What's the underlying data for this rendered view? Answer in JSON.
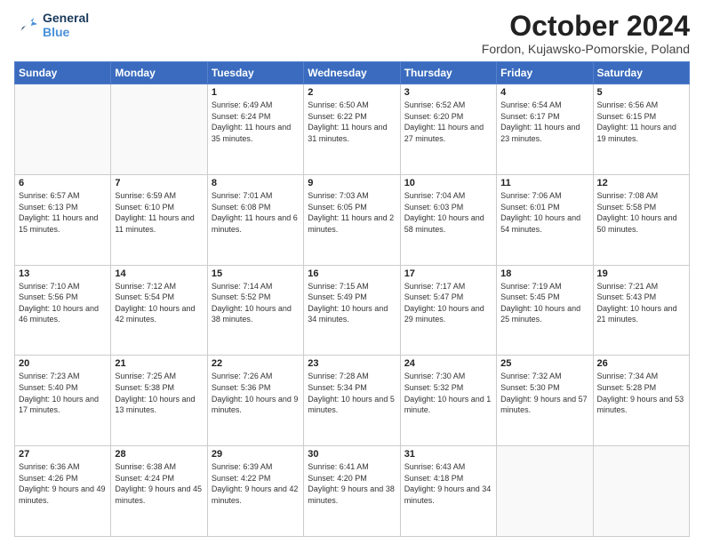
{
  "header": {
    "logo_line1": "General",
    "logo_line2": "Blue",
    "month": "October 2024",
    "location": "Fordon, Kujawsko-Pomorskie, Poland"
  },
  "days_of_week": [
    "Sunday",
    "Monday",
    "Tuesday",
    "Wednesday",
    "Thursday",
    "Friday",
    "Saturday"
  ],
  "weeks": [
    [
      {
        "day": "",
        "info": ""
      },
      {
        "day": "",
        "info": ""
      },
      {
        "day": "1",
        "info": "Sunrise: 6:49 AM\nSunset: 6:24 PM\nDaylight: 11 hours and 35 minutes."
      },
      {
        "day": "2",
        "info": "Sunrise: 6:50 AM\nSunset: 6:22 PM\nDaylight: 11 hours and 31 minutes."
      },
      {
        "day": "3",
        "info": "Sunrise: 6:52 AM\nSunset: 6:20 PM\nDaylight: 11 hours and 27 minutes."
      },
      {
        "day": "4",
        "info": "Sunrise: 6:54 AM\nSunset: 6:17 PM\nDaylight: 11 hours and 23 minutes."
      },
      {
        "day": "5",
        "info": "Sunrise: 6:56 AM\nSunset: 6:15 PM\nDaylight: 11 hours and 19 minutes."
      }
    ],
    [
      {
        "day": "6",
        "info": "Sunrise: 6:57 AM\nSunset: 6:13 PM\nDaylight: 11 hours and 15 minutes."
      },
      {
        "day": "7",
        "info": "Sunrise: 6:59 AM\nSunset: 6:10 PM\nDaylight: 11 hours and 11 minutes."
      },
      {
        "day": "8",
        "info": "Sunrise: 7:01 AM\nSunset: 6:08 PM\nDaylight: 11 hours and 6 minutes."
      },
      {
        "day": "9",
        "info": "Sunrise: 7:03 AM\nSunset: 6:05 PM\nDaylight: 11 hours and 2 minutes."
      },
      {
        "day": "10",
        "info": "Sunrise: 7:04 AM\nSunset: 6:03 PM\nDaylight: 10 hours and 58 minutes."
      },
      {
        "day": "11",
        "info": "Sunrise: 7:06 AM\nSunset: 6:01 PM\nDaylight: 10 hours and 54 minutes."
      },
      {
        "day": "12",
        "info": "Sunrise: 7:08 AM\nSunset: 5:58 PM\nDaylight: 10 hours and 50 minutes."
      }
    ],
    [
      {
        "day": "13",
        "info": "Sunrise: 7:10 AM\nSunset: 5:56 PM\nDaylight: 10 hours and 46 minutes."
      },
      {
        "day": "14",
        "info": "Sunrise: 7:12 AM\nSunset: 5:54 PM\nDaylight: 10 hours and 42 minutes."
      },
      {
        "day": "15",
        "info": "Sunrise: 7:14 AM\nSunset: 5:52 PM\nDaylight: 10 hours and 38 minutes."
      },
      {
        "day": "16",
        "info": "Sunrise: 7:15 AM\nSunset: 5:49 PM\nDaylight: 10 hours and 34 minutes."
      },
      {
        "day": "17",
        "info": "Sunrise: 7:17 AM\nSunset: 5:47 PM\nDaylight: 10 hours and 29 minutes."
      },
      {
        "day": "18",
        "info": "Sunrise: 7:19 AM\nSunset: 5:45 PM\nDaylight: 10 hours and 25 minutes."
      },
      {
        "day": "19",
        "info": "Sunrise: 7:21 AM\nSunset: 5:43 PM\nDaylight: 10 hours and 21 minutes."
      }
    ],
    [
      {
        "day": "20",
        "info": "Sunrise: 7:23 AM\nSunset: 5:40 PM\nDaylight: 10 hours and 17 minutes."
      },
      {
        "day": "21",
        "info": "Sunrise: 7:25 AM\nSunset: 5:38 PM\nDaylight: 10 hours and 13 minutes."
      },
      {
        "day": "22",
        "info": "Sunrise: 7:26 AM\nSunset: 5:36 PM\nDaylight: 10 hours and 9 minutes."
      },
      {
        "day": "23",
        "info": "Sunrise: 7:28 AM\nSunset: 5:34 PM\nDaylight: 10 hours and 5 minutes."
      },
      {
        "day": "24",
        "info": "Sunrise: 7:30 AM\nSunset: 5:32 PM\nDaylight: 10 hours and 1 minute."
      },
      {
        "day": "25",
        "info": "Sunrise: 7:32 AM\nSunset: 5:30 PM\nDaylight: 9 hours and 57 minutes."
      },
      {
        "day": "26",
        "info": "Sunrise: 7:34 AM\nSunset: 5:28 PM\nDaylight: 9 hours and 53 minutes."
      }
    ],
    [
      {
        "day": "27",
        "info": "Sunrise: 6:36 AM\nSunset: 4:26 PM\nDaylight: 9 hours and 49 minutes."
      },
      {
        "day": "28",
        "info": "Sunrise: 6:38 AM\nSunset: 4:24 PM\nDaylight: 9 hours and 45 minutes."
      },
      {
        "day": "29",
        "info": "Sunrise: 6:39 AM\nSunset: 4:22 PM\nDaylight: 9 hours and 42 minutes."
      },
      {
        "day": "30",
        "info": "Sunrise: 6:41 AM\nSunset: 4:20 PM\nDaylight: 9 hours and 38 minutes."
      },
      {
        "day": "31",
        "info": "Sunrise: 6:43 AM\nSunset: 4:18 PM\nDaylight: 9 hours and 34 minutes."
      },
      {
        "day": "",
        "info": ""
      },
      {
        "day": "",
        "info": ""
      }
    ]
  ]
}
